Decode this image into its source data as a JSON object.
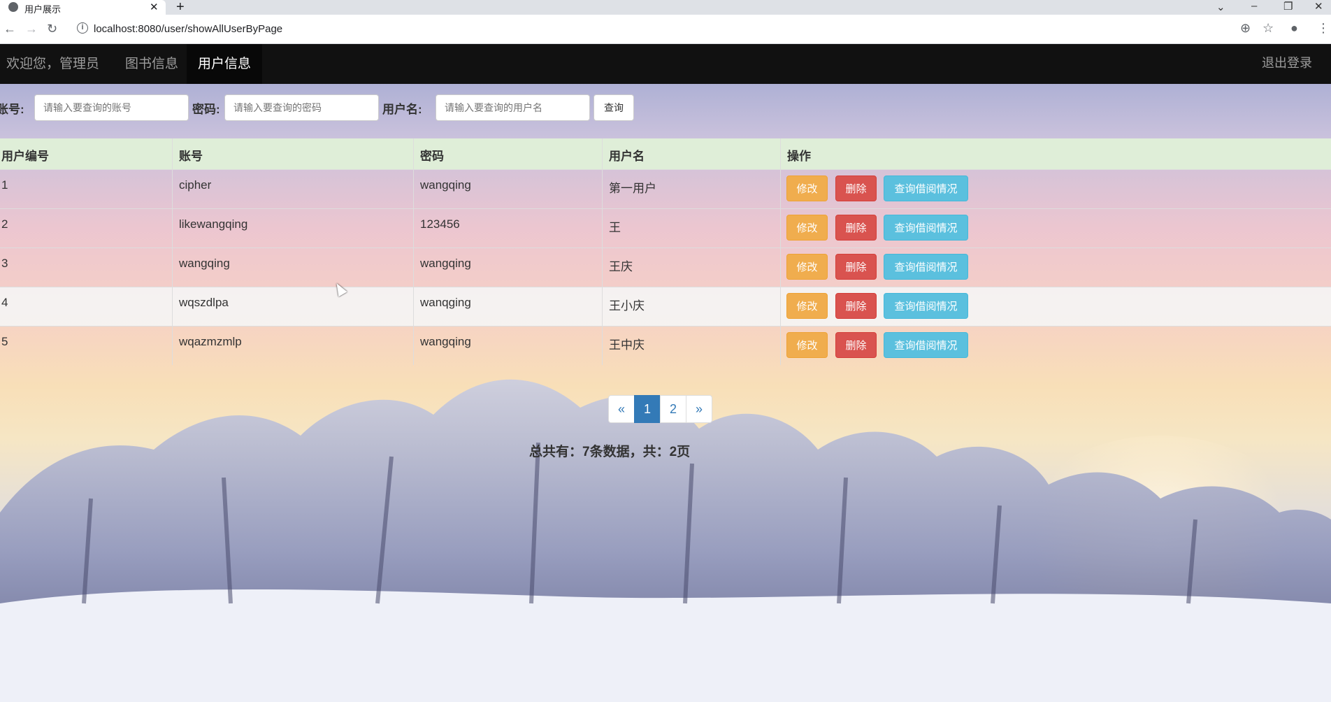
{
  "browser": {
    "tab_title": "用户展示",
    "url": "localhost:8080/user/showAllUserByPage",
    "new_tab": "+",
    "tab_close": "✕"
  },
  "navbar": {
    "brand": "欢迎您，管理员",
    "items": [
      {
        "label": "图书信息",
        "active": false
      },
      {
        "label": "用户信息",
        "active": true
      }
    ],
    "logout": "退出登录"
  },
  "search": {
    "account_label": "账号:",
    "account_placeholder": "请输入要查询的账号",
    "password_label": "密码:",
    "password_placeholder": "请输入要查询的密码",
    "username_label": "用户名:",
    "username_placeholder": "请输入要查询的用户名",
    "query_button": "查询"
  },
  "table": {
    "headers": [
      "用户编号",
      "账号",
      "密码",
      "用户名",
      "操作"
    ],
    "rows": [
      {
        "id": "1",
        "account": "cipher",
        "password": "wangqing",
        "username": "第一用户"
      },
      {
        "id": "2",
        "account": "likewangqing",
        "password": "123456",
        "username": "王"
      },
      {
        "id": "3",
        "account": "wangqing",
        "password": "wangqing",
        "username": "王庆"
      },
      {
        "id": "4",
        "account": "wqszdlpa",
        "password": "wanqging",
        "username": "王小庆"
      },
      {
        "id": "5",
        "account": "wqazmzmlp",
        "password": "wangqing",
        "username": "王中庆"
      }
    ],
    "actions": {
      "edit": "修改",
      "delete": "删除",
      "borrow": "查询借阅情况"
    }
  },
  "pagination": {
    "prev": "«",
    "pages": [
      "1",
      "2"
    ],
    "current": "1",
    "next": "»"
  },
  "summary": "总共有：7条数据，共：2页",
  "colors": {
    "navbar": "#111111",
    "table_header": "#dff0d8",
    "edit_button": "#f0ad4e",
    "delete_button": "#d9534f",
    "borrow_button": "#5bc0de",
    "pager_active": "#337ab7"
  }
}
